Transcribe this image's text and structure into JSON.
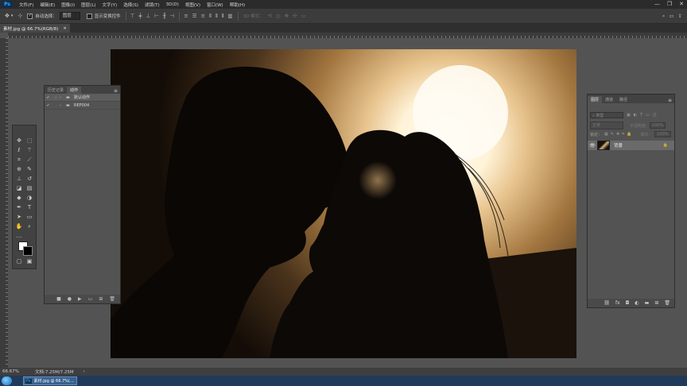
{
  "app": {
    "logo": "Ps",
    "menu": [
      "文件(F)",
      "编辑(E)",
      "图像(I)",
      "图层(L)",
      "文字(Y)",
      "选择(S)",
      "滤镜(T)",
      "3D(D)",
      "视图(V)",
      "窗口(W)",
      "帮助(H)"
    ],
    "window_controls": [
      "—",
      "❐",
      "✕"
    ]
  },
  "options_bar": {
    "auto_select_label": "自动选择：",
    "auto_select_checked": true,
    "target_value": "图层",
    "show_transform_label": "显示变换控件",
    "show_transform_checked": false,
    "mode_3d_label": "3D 模式："
  },
  "document": {
    "tab_title": "素材.jpg @ 66.7%(RGB/8)",
    "close_glyph": "×"
  },
  "actions_panel": {
    "tabs": [
      "历史记录",
      "动作"
    ],
    "active_tab": 1,
    "items": [
      {
        "label": "默认动作",
        "checked": true
      },
      {
        "label": "REP004",
        "checked": true
      }
    ]
  },
  "layers_panel": {
    "tabs": [
      "图层",
      "通道",
      "路径"
    ],
    "active_tab": 0,
    "filter_placeholder": "类型",
    "blend_mode": "正常",
    "opacity_label": "不透明度：",
    "opacity_value": "100%",
    "lock_label": "锁定：",
    "fill_label": "填充：",
    "fill_value": "100%",
    "layers": [
      {
        "name": "背景",
        "visible": true,
        "locked": true
      }
    ]
  },
  "status_bar": {
    "zoom": "66.67%",
    "doc_info": "文档:7.25M/7.25M",
    "arrow": "›"
  },
  "taskbar": {
    "task_label": "素材.jpg @ 66.7%(..."
  }
}
